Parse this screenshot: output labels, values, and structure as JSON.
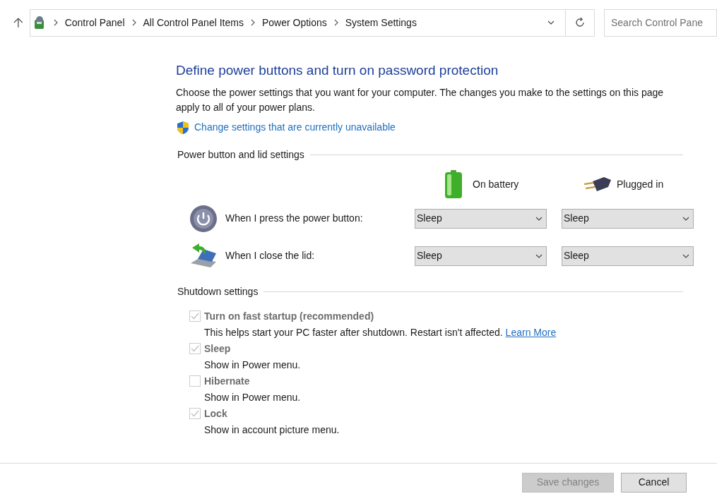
{
  "address_bar": {
    "breadcrumbs": [
      "Control Panel",
      "All Control Panel Items",
      "Power Options",
      "System Settings"
    ]
  },
  "search": {
    "placeholder": "Search Control Pane"
  },
  "page": {
    "title": "Define power buttons and turn on password protection",
    "description": "Choose the power settings that you want for your computer. The changes you make to the settings on this page apply to all of your power plans.",
    "admin_link": "Change settings that are currently unavailable"
  },
  "power_section": {
    "heading": "Power button and lid settings",
    "columns": [
      "On battery",
      "Plugged in"
    ],
    "rows": [
      {
        "label": "When I press the power button:",
        "values": [
          "Sleep",
          "Sleep"
        ]
      },
      {
        "label": "When I close the lid:",
        "values": [
          "Sleep",
          "Sleep"
        ]
      }
    ]
  },
  "shutdown_section": {
    "heading": "Shutdown settings",
    "options": [
      {
        "label": "Turn on fast startup (recommended)",
        "description": "This helps start your PC faster after shutdown. Restart isn't affected.",
        "link": "Learn More",
        "checked": true,
        "disabled": true
      },
      {
        "label": "Sleep",
        "description": "Show in Power menu.",
        "checked": true,
        "disabled": true
      },
      {
        "label": "Hibernate",
        "description": "Show in Power menu.",
        "checked": false,
        "disabled": true
      },
      {
        "label": "Lock",
        "description": "Show in account picture menu.",
        "checked": true,
        "disabled": true
      }
    ]
  },
  "buttons": [
    {
      "label": "Save changes",
      "disabled": true
    },
    {
      "label": "Cancel",
      "disabled": false
    }
  ]
}
